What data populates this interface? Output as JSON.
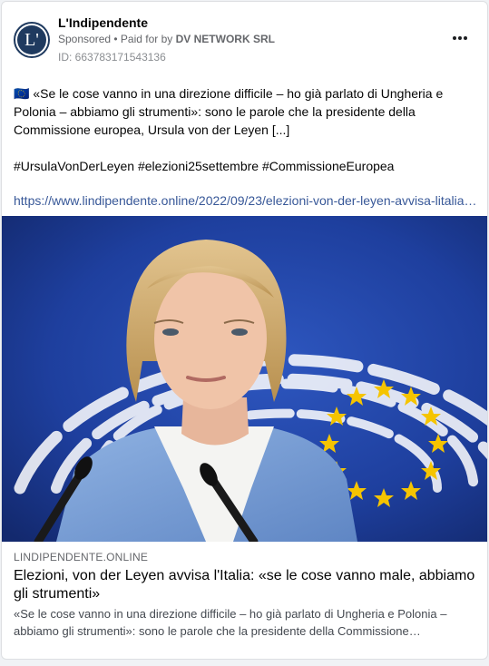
{
  "ad": {
    "page_name": "L'Indipendente",
    "avatar_letter": "L'",
    "sponsored_label": "Sponsored",
    "separator": " • Paid for by ",
    "payer": "DV NETWORK SRL",
    "ad_id": "ID: 663783171543136",
    "more_icon": "more-options-icon"
  },
  "post": {
    "body": "🇪🇺 «Se le cose vanno in una direzione difficile – ho già parlato di Ungheria e Polonia – abbiamo gli strumenti»: sono le parole che la presidente della Commissione europea, Ursula von der Leyen [...]",
    "hashtags": "#UrsulaVonDerLeyen #elezioni25settembre #CommissioneEuropea",
    "url": "https://www.lindipendente.online/2022/09/23/elezioni-von-der-leyen-avvisa-litalia-se-le-cose-vanno-male-abbiamo-gli-strumenti/"
  },
  "link_preview": {
    "domain": "LINDIPENDENTE.ONLINE",
    "title": "Elezioni, von der Leyen avvisa l'Italia: «se le cose vanno male, abbiamo gli strumenti»",
    "description": "«Se le cose vanno in una direzione difficile – ho già parlato di Ungheria e Polonia – abbiamo gli strumenti»: sono le parole che la presidente della Commissione…"
  },
  "colors": {
    "link": "#385898",
    "eu_blue": "#1e3f9e",
    "star": "#f5c400"
  }
}
